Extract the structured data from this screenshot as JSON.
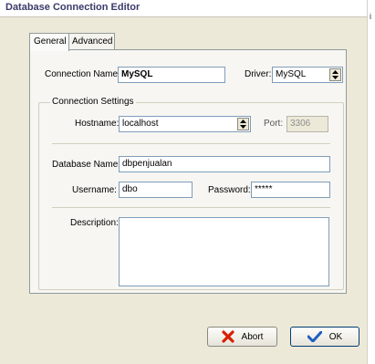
{
  "window": {
    "title": "Database Connection Editor"
  },
  "edge_mark": "i",
  "tabs": [
    {
      "label": "General",
      "active": true
    },
    {
      "label": "Advanced",
      "active": false
    }
  ],
  "connection": {
    "name_label": "Connection Name:",
    "name_value": "MySQL",
    "driver_label": "Driver:",
    "driver_value": "MySQL"
  },
  "settings": {
    "group_title": "Connection Settings",
    "hostname_label": "Hostname:",
    "hostname_value": "localhost",
    "port_label": "Port:",
    "port_value": "3306",
    "database_label": "Database Name:",
    "database_value": "dbpenjualan",
    "username_label": "Username:",
    "username_value": "dbo",
    "password_label": "Password:",
    "password_value": "*****",
    "description_label": "Description:",
    "description_value": ""
  },
  "buttons": {
    "abort_label": "Abort",
    "ok_label": "OK"
  },
  "colors": {
    "abort_icon": "#d81e05",
    "ok_icon": "#1f5fbf"
  }
}
